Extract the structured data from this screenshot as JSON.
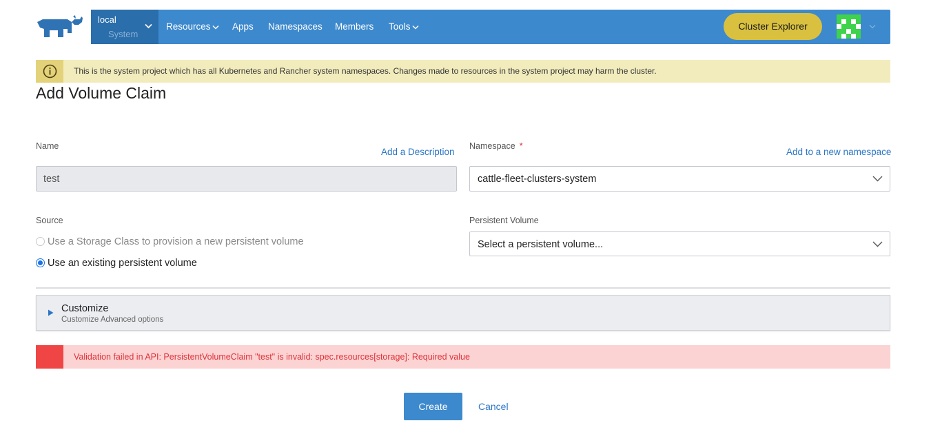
{
  "header": {
    "cluster_name": "local",
    "project_name": "System",
    "nav": {
      "resources": "Resources",
      "apps": "Apps",
      "namespaces": "Namespaces",
      "members": "Members",
      "tools": "Tools"
    },
    "cluster_explorer": "Cluster Explorer"
  },
  "banner": {
    "icon": "info-icon",
    "text": "This is the system project which has all Kubernetes and Rancher system namespaces. Changes made to resources in the system project may harm the cluster."
  },
  "page": {
    "title": "Add Volume Claim"
  },
  "form": {
    "name_label": "Name",
    "add_description": "Add a Description",
    "name_value": "test",
    "namespace_label": "Namespace",
    "required_marker": "*",
    "add_namespace": "Add to a new namespace",
    "namespace_value": "cattle-fleet-clusters-system",
    "source_label": "Source",
    "source_options": [
      "Use a Storage Class to provision a new persistent volume",
      "Use an existing persistent volume"
    ],
    "source_selected": 1,
    "pv_label": "Persistent Volume",
    "pv_placeholder": "Select a persistent volume..."
  },
  "customize": {
    "title": "Customize",
    "subtitle": "Customize Advanced options"
  },
  "error": {
    "text": "Validation failed in API: PersistentVolumeClaim \"test\" is invalid: spec.resources[storage]: Required value"
  },
  "actions": {
    "create": "Create",
    "cancel": "Cancel"
  },
  "colors": {
    "nav_bg": "#3d89cd",
    "cluster_bg": "#2a6eab",
    "explorer_btn": "#d9c13f",
    "link": "#2a76c6",
    "warning_bg": "#f2ecbd",
    "error_bg": "#fbd3d3",
    "error_accent": "#f04545"
  }
}
